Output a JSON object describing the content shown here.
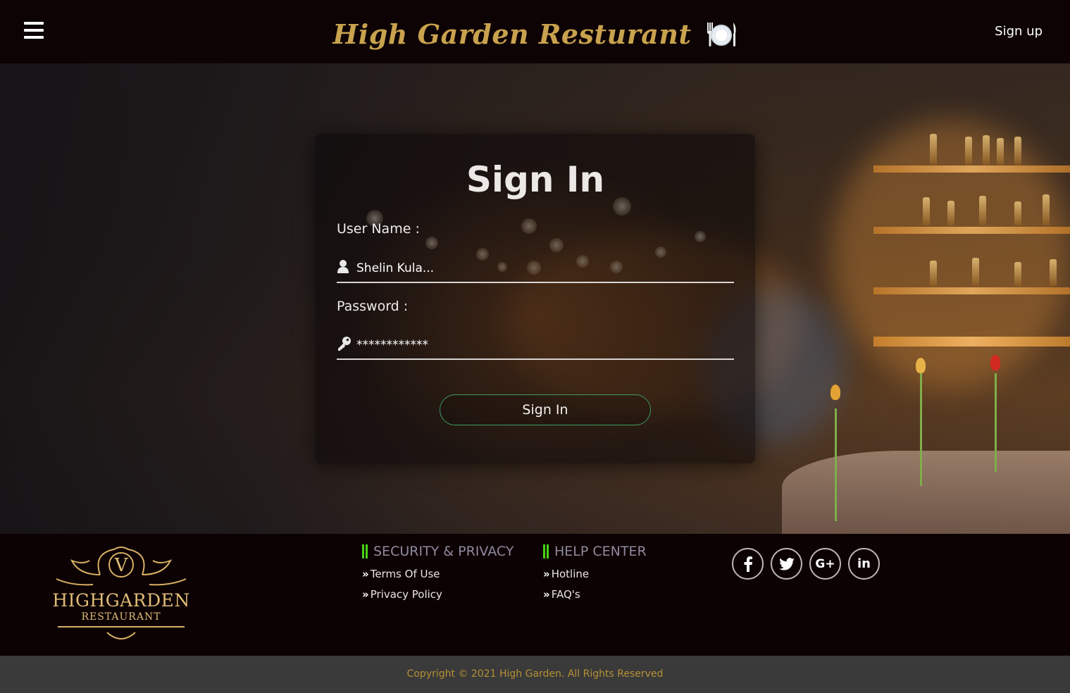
{
  "header": {
    "title": "High Garden Resturant",
    "signup_label": "Sign up",
    "menu_icon": "hamburger-menu-icon",
    "brand_icon": "plate-cutlery-icon"
  },
  "signin": {
    "title": "Sign In",
    "username_label": "User Name :",
    "username_value": "Shelin Kula...",
    "password_label": "Password :",
    "password_value": "************",
    "button_label": "Sign In"
  },
  "footer": {
    "logo": {
      "letter": "V",
      "name": "HIGHGARDEN",
      "sub": "RESTAURANT"
    },
    "security": {
      "heading": "SECURITY & PRIVACY",
      "links": [
        "Terms Of Use",
        "Privacy Policy"
      ]
    },
    "help": {
      "heading": "HELP CENTER",
      "links": [
        "Hotline",
        "FAQ's"
      ]
    },
    "socials": [
      {
        "icon": "facebook-icon",
        "glyph": "f"
      },
      {
        "icon": "twitter-icon",
        "glyph": "🐦"
      },
      {
        "icon": "google-plus-icon",
        "glyph": "G+"
      },
      {
        "icon": "linkedin-icon",
        "glyph": "in"
      }
    ],
    "copyright": "Copyright © 2021 High Garden. All Rights Reserved"
  },
  "colors": {
    "brand_gold": "#c9a24e",
    "accent_green": "#49d316",
    "button_border": "#3f9a62",
    "copyright_text": "#b69035"
  }
}
